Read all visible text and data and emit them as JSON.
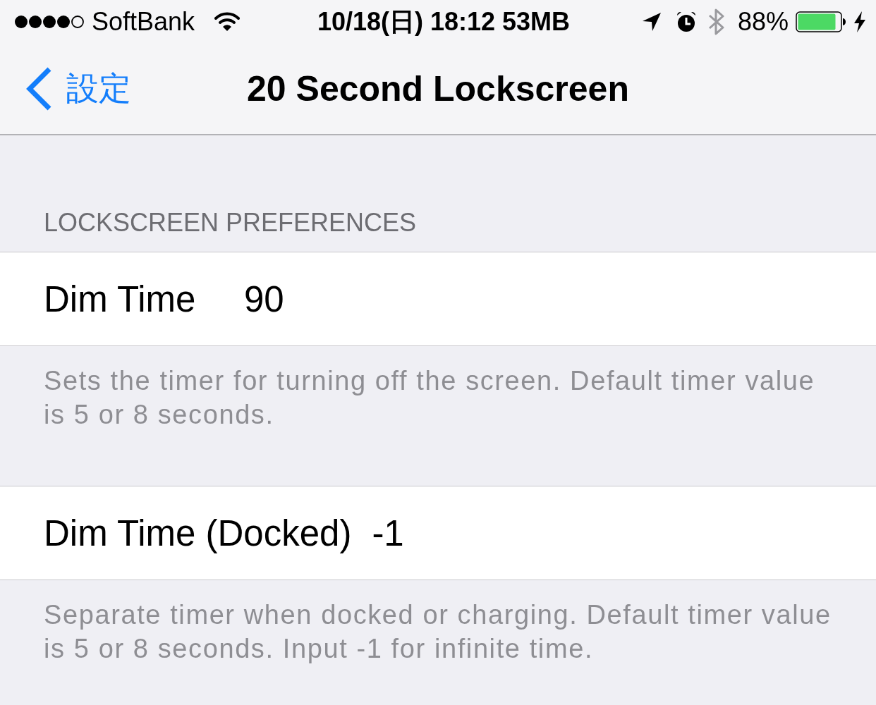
{
  "status_bar": {
    "carrier": "SoftBank",
    "time": "10/18(日) 18:12 53MB",
    "battery": "88%"
  },
  "nav_bar": {
    "back": "設定",
    "title": "20 Second Lockscreen"
  },
  "section": {
    "header": "LOCKSCREEN PREFERENCES"
  },
  "fields": [
    {
      "label": "Dim Time",
      "value": "90",
      "footer": "Sets the timer for turning off the screen. Default timer value is 5 or 8 seconds."
    },
    {
      "label": "Dim Time (Docked)",
      "value": "-1",
      "footer": "Separate timer when docked or charging. Default timer value is 5 or 8 seconds. Input -1 for infinite time."
    }
  ]
}
